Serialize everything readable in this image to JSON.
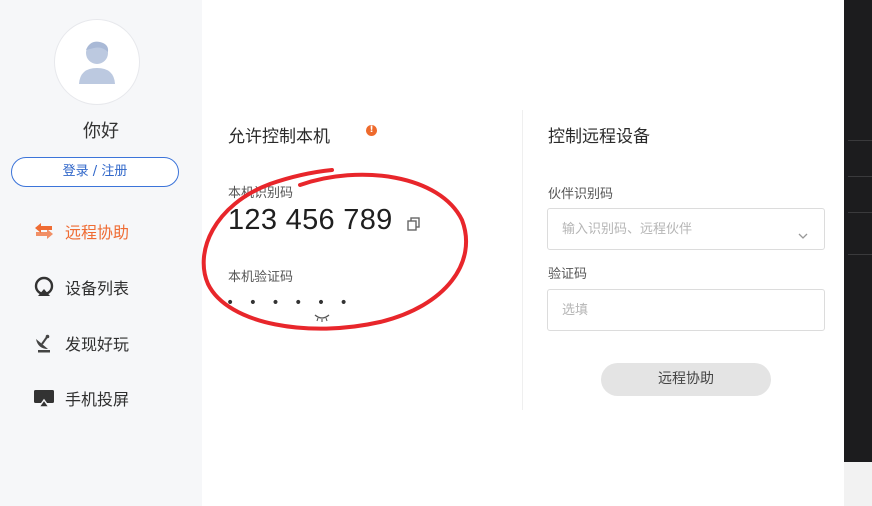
{
  "sidebar": {
    "greeting": "你好",
    "login_label": "登录 / 注册",
    "items": [
      {
        "label": "远程协助",
        "icon": "swap-arrows-icon",
        "active": true
      },
      {
        "label": "设备列表",
        "icon": "device-list-icon",
        "active": false
      },
      {
        "label": "发现好玩",
        "icon": "satellite-dish-icon",
        "active": false
      },
      {
        "label": "手机投屏",
        "icon": "screen-cast-icon",
        "active": false
      }
    ]
  },
  "allow_control": {
    "title": "允许控制本机",
    "warning_icon": "warning-dot-icon",
    "id_label": "本机识别码",
    "id_value": "123 456 789",
    "code_label": "本机验证码",
    "code_value": "• • • • • •"
  },
  "remote_control": {
    "title": "控制远程设备",
    "partner_label": "伙伴识别码",
    "partner_placeholder": "输入识别码、远程伙伴",
    "code_label": "验证码",
    "code_placeholder": "选填",
    "assist_button": "远程协助"
  },
  "colors": {
    "accent_orange": "#ef6c34",
    "login_blue": "#3c74d9",
    "highlight_red": "#e8262b"
  }
}
